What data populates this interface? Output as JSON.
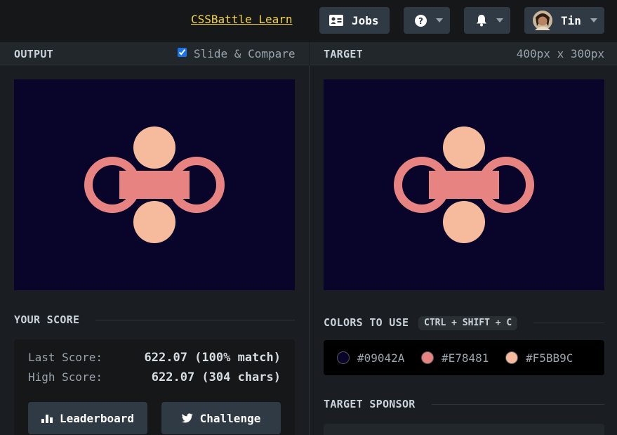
{
  "topbar": {
    "learn_link": "CSSBattle Learn",
    "jobs_label": "Jobs",
    "user_name": "Tin",
    "icons": [
      "id-card-icon",
      "help-icon",
      "bell-icon",
      "avatar"
    ]
  },
  "output_panel": {
    "title": "OUTPUT",
    "slide_compare_label": "Slide & Compare",
    "slide_compare_checked": true
  },
  "target_panel": {
    "title": "TARGET",
    "dimensions": "400px x 300px"
  },
  "score": {
    "section_title": "YOUR SCORE",
    "last_label": "Last Score:",
    "last_value": "622.07 (100% match)",
    "high_label": "High Score:",
    "high_value": "622.07 (304 chars)",
    "leaderboard_label": "Leaderboard",
    "challenge_label": "Challenge"
  },
  "colors": {
    "section_title": "COLORS TO USE",
    "shortcut": "CTRL + SHIFT + C",
    "items": [
      {
        "hex": "#09042A"
      },
      {
        "hex": "#E78481"
      },
      {
        "hex": "#F5BB9C"
      }
    ]
  },
  "sponsor": {
    "section_title": "TARGET SPONSOR"
  },
  "theme": {
    "accent_link": "#f5d547",
    "background": "#1a1e22",
    "button": "#2f3a44"
  }
}
